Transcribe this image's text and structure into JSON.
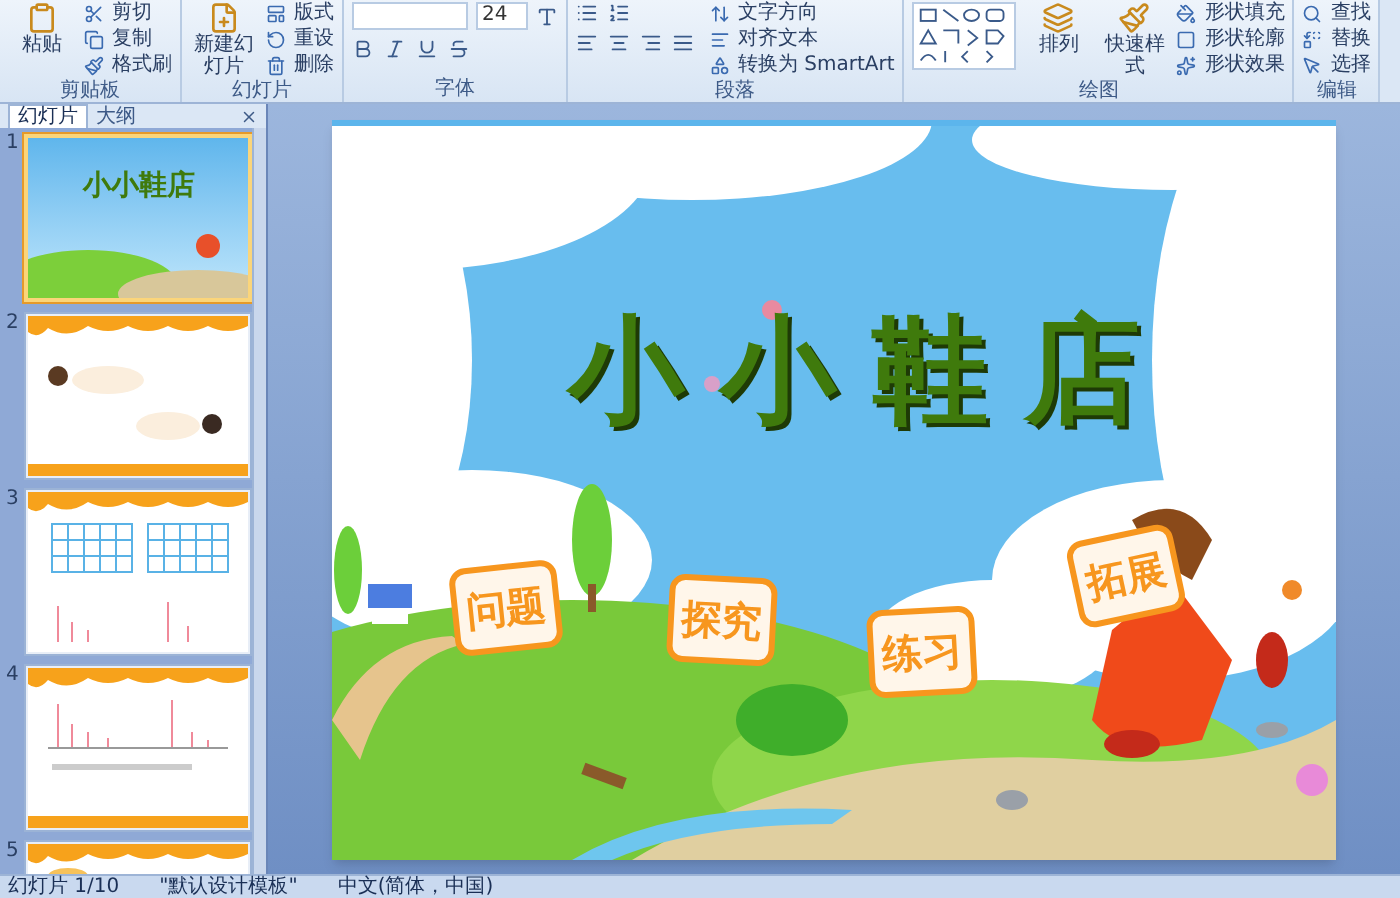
{
  "ribbon": {
    "groups": [
      {
        "label": "剪贴板",
        "kind": "buttons",
        "large": [
          "粘贴"
        ],
        "small": [
          "剪切",
          "复制",
          "格式刷"
        ]
      },
      {
        "label": "幻灯片",
        "kind": "buttons",
        "large": [
          "新建幻灯片"
        ],
        "small": [
          "版式",
          "重设",
          "删除"
        ]
      },
      {
        "label": "字体",
        "kind": "font",
        "font_size": "24"
      },
      {
        "label": "段落",
        "kind": "paragraph",
        "small": [
          "文字方向",
          "对齐文本",
          "转换为 SmartArt"
        ]
      },
      {
        "label": "绘图",
        "kind": "drawing",
        "large": [
          "排列",
          "快速样式"
        ],
        "small": [
          "形状填充",
          "形状轮廓",
          "形状效果"
        ]
      },
      {
        "label": "编辑",
        "kind": "buttons",
        "small": [
          "查找",
          "替换",
          "选择"
        ]
      }
    ]
  },
  "panel": {
    "tabs": [
      {
        "label": "幻灯片",
        "selected": true
      },
      {
        "label": "大纲",
        "selected": false
      }
    ],
    "thumbnails": [
      {
        "number": "1",
        "kind": "title",
        "title": "小小鞋店",
        "selected": true
      },
      {
        "number": "2",
        "kind": "dialog",
        "selected": false
      },
      {
        "number": "3",
        "kind": "table",
        "selected": false
      },
      {
        "number": "4",
        "kind": "chart",
        "selected": false
      },
      {
        "number": "5",
        "kind": "partial",
        "selected": false
      }
    ]
  },
  "slide": {
    "title": "小小鞋店",
    "buttons": [
      "问题",
      "探究",
      "练习",
      "拓展"
    ]
  },
  "status_bar": {
    "slide_counter": "幻灯片 1/10",
    "theme": "\"默认设计模板\"",
    "language": "中文(简体，中国)"
  }
}
